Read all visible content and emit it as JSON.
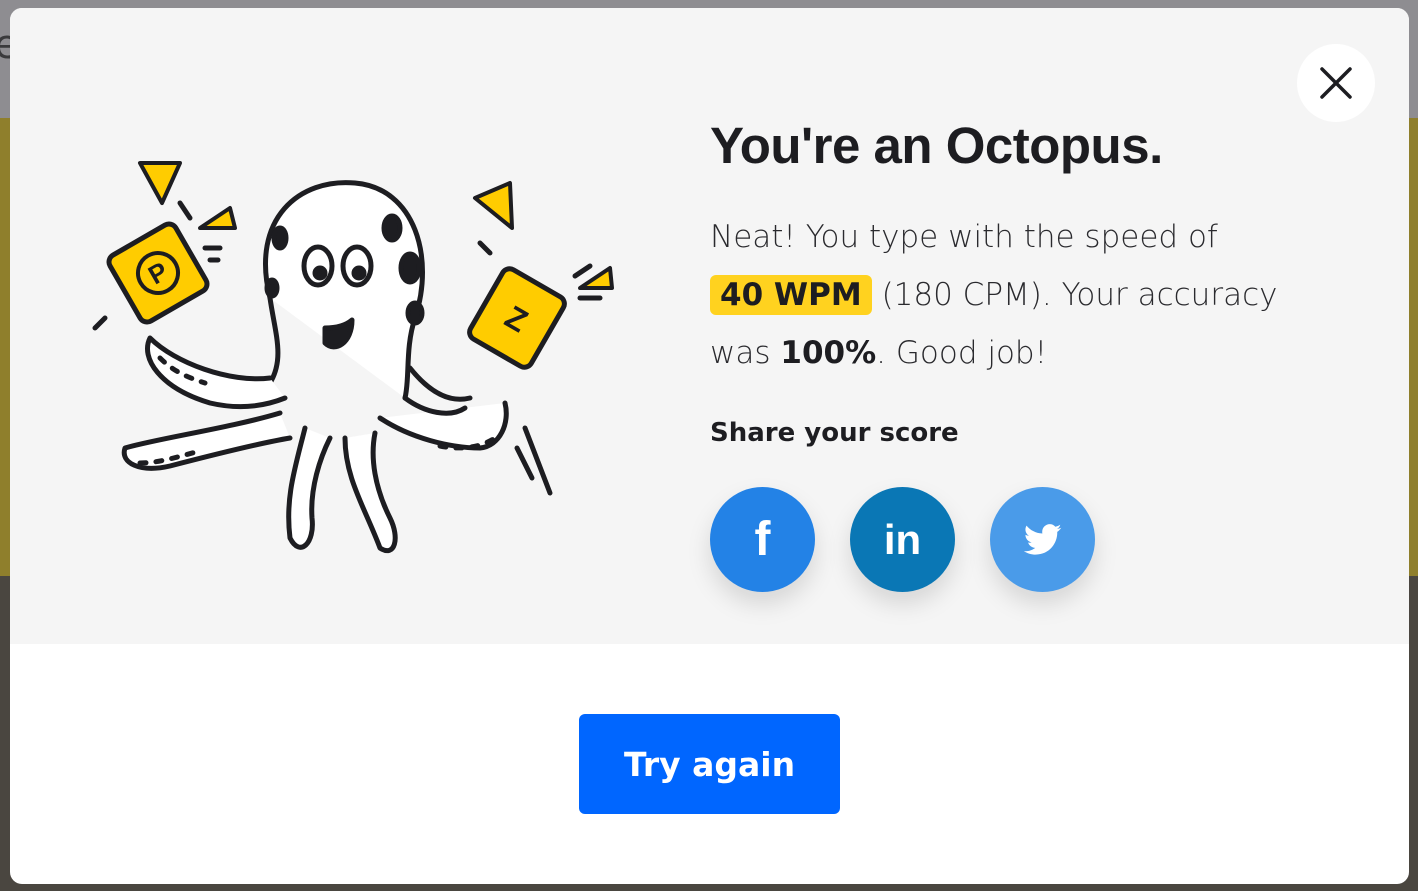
{
  "background": {
    "partial_letter": "e"
  },
  "dialog": {
    "close_icon": "close-icon",
    "title": "You're an Octopus.",
    "result": {
      "intro": "Neat! You type with the speed of",
      "wpm": "40 WPM",
      "cpm": "(180 CPM). Your accuracy",
      "accuracy_prefix": "was",
      "accuracy": "100%",
      "closing": ". Good job!"
    },
    "share": {
      "label": "Share your score",
      "buttons": [
        {
          "label": "f",
          "icon": "facebook-icon",
          "color": "#2382e6"
        },
        {
          "label": "in",
          "icon": "linkedin-icon",
          "color": "#0a77b5"
        },
        {
          "label": "",
          "icon": "twitter-icon",
          "color": "#4a9be9"
        }
      ]
    },
    "illustration": {
      "key_letters": [
        "P",
        "Z"
      ],
      "accent": "#ffcc00"
    },
    "try_again_label": "Try again"
  }
}
